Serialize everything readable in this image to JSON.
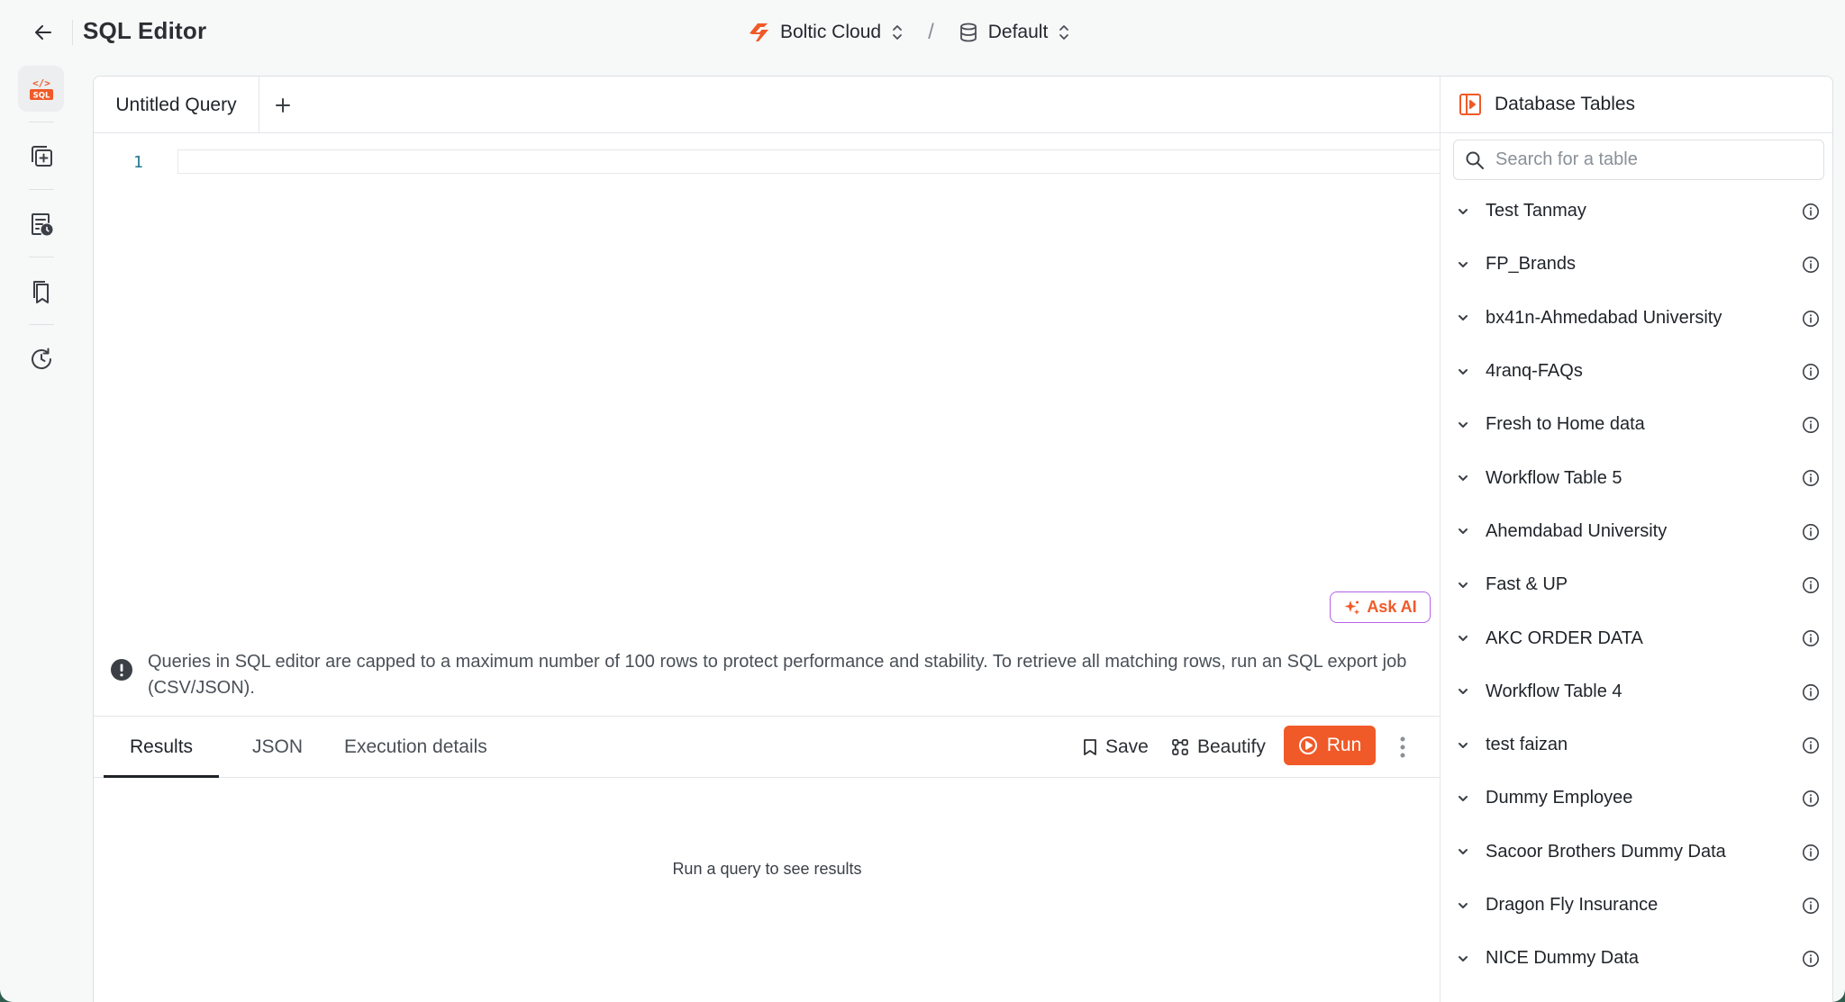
{
  "header": {
    "title": "SQL Editor",
    "workspace": "Boltic Cloud",
    "database": "Default",
    "separator": "/"
  },
  "rail": {
    "items": [
      {
        "name": "sql-editor",
        "label": "SQL",
        "active": true
      },
      {
        "name": "new-query",
        "active": false
      },
      {
        "name": "scheduled-queries",
        "active": false
      },
      {
        "name": "saved-queries",
        "active": false
      },
      {
        "name": "query-history",
        "active": false
      }
    ]
  },
  "tabs": [
    {
      "label": "Untitled Query",
      "active": true
    }
  ],
  "editor": {
    "line_number": "1",
    "query": ""
  },
  "ask_ai": {
    "label": "Ask AI"
  },
  "notice": {
    "text": "Queries in SQL editor are capped to a maximum number of 100 rows to protect performance and stability. To retrieve all matching rows, run an SQL export job (CSV/JSON)."
  },
  "results": {
    "tabs": [
      "Results",
      "JSON",
      "Execution details"
    ],
    "active_tab": "Results",
    "empty_text": "Run a query to see results"
  },
  "actions": {
    "save": "Save",
    "beautify": "Beautify",
    "run": "Run"
  },
  "database_tables": {
    "title": "Database Tables",
    "search_placeholder": "Search for a table",
    "tables": [
      "Test Tanmay",
      "FP_Brands",
      "bx41n-Ahmedabad University",
      "4ranq-FAQs",
      "Fresh to Home data",
      "Workflow Table 5",
      "Ahemdabad University",
      "Fast & UP",
      "AKC ORDER DATA",
      "Workflow Table 4",
      "test faizan",
      "Dummy Employee",
      "Sacoor Brothers Dummy Data",
      "Dragon Fly Insurance",
      "NICE Dummy Data"
    ]
  },
  "colors": {
    "accent": "#f05a28",
    "ai_border": "#b660e8",
    "line_number": "#237893",
    "background": "#f7f8f8"
  }
}
